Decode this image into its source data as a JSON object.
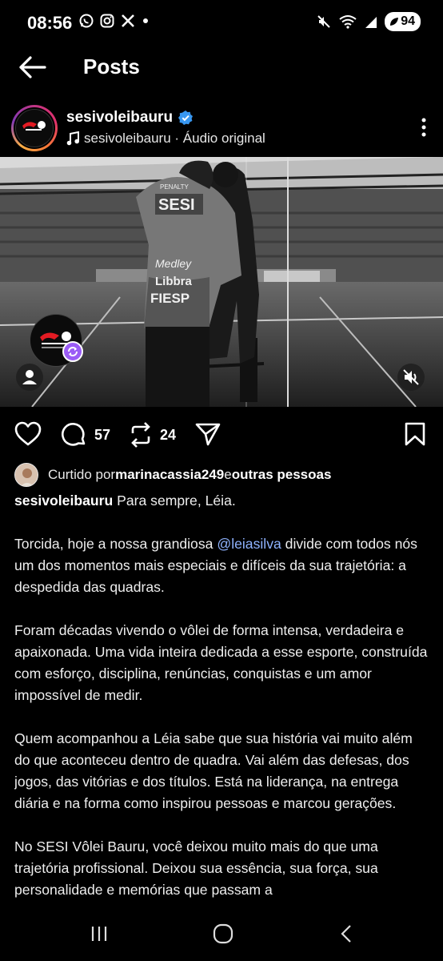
{
  "status": {
    "time": "08:56",
    "battery": "94"
  },
  "header": {
    "title": "Posts"
  },
  "post": {
    "username": "sesivoleibauru",
    "audio": "sesivoleibauru · Áudio original",
    "comments_count": "57",
    "reposts_count": "24"
  },
  "liked_by": {
    "prefix": "Curtido por ",
    "user": "marinacassia249",
    "joiner": " e ",
    "others": "outras pessoas"
  },
  "caption": {
    "username": "sesivoleibauru",
    "first_line": " Para sempre, Léia.",
    "p1_before": "Torcida, hoje a nossa grandiosa ",
    "p1_mention": "@leiasilva",
    "p1_after": " divide com todos nós um dos momentos mais especiais e difíceis da sua trajetória: a despedida das quadras.",
    "p2": "Foram décadas vivendo o vôlei de forma intensa, verdadeira e apaixonada. Uma vida inteira dedicada a esse esporte, construída com esforço, disciplina, renúncias, conquistas e um amor impossível de medir.",
    "p3": "Quem acompanhou a Léia sabe que sua história vai muito além do que aconteceu dentro de quadra. Vai além das defesas, dos jogos, das vitórias e dos títulos. Está na liderança, na entrega diária e na forma como inspirou pessoas e marcou gerações.",
    "p4": "No SESI Vôlei Bauru, você deixou muito mais do que uma trajetória profissional. Deixou sua essência, sua força, sua personalidade e memórias que passam a"
  },
  "media": {
    "jersey_text": "SESI",
    "sponsor_1": "Medley",
    "sponsor_2": "Libbra",
    "sponsor_3": "FIESP",
    "brand": "PENALTY"
  },
  "icons": {
    "back": "arrow-left-icon",
    "verified": "verified-badge-icon",
    "music": "music-note-icon",
    "more": "more-vertical-icon",
    "like": "heart-icon",
    "comment": "comment-icon",
    "repost": "repost-icon",
    "share": "send-icon",
    "save": "bookmark-icon",
    "tag": "person-icon",
    "mute": "speaker-muted-icon"
  },
  "colors": {
    "background": "#000000",
    "verified": "#3897f0",
    "mention": "#8fb3ff",
    "reel_badge": "#9b5cf6"
  }
}
